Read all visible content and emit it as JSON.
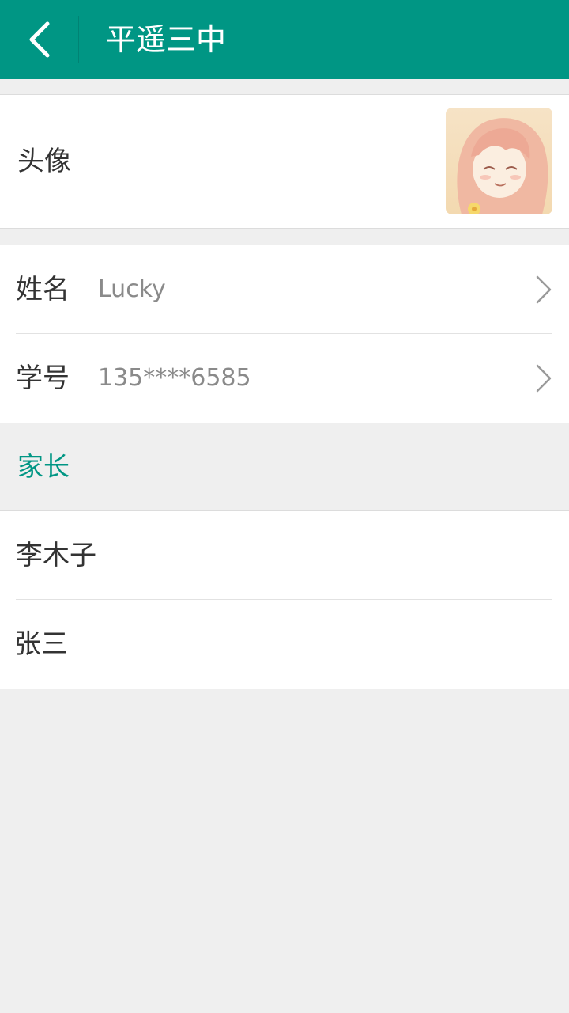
{
  "topbar": {
    "title": "平遥三中",
    "back_icon": "chevron-left-icon"
  },
  "profile": {
    "avatar_label": "头像",
    "name_label": "姓名",
    "name_value": "Lucky",
    "id_label": "学号",
    "id_value": "135****6585"
  },
  "parents": {
    "section_title": "家长",
    "items": [
      {
        "name": "李木子"
      },
      {
        "name": "张三"
      }
    ]
  },
  "colors": {
    "accent": "#009684",
    "background": "#efefef",
    "text_primary": "#333333",
    "text_secondary": "#8a8a8a"
  }
}
